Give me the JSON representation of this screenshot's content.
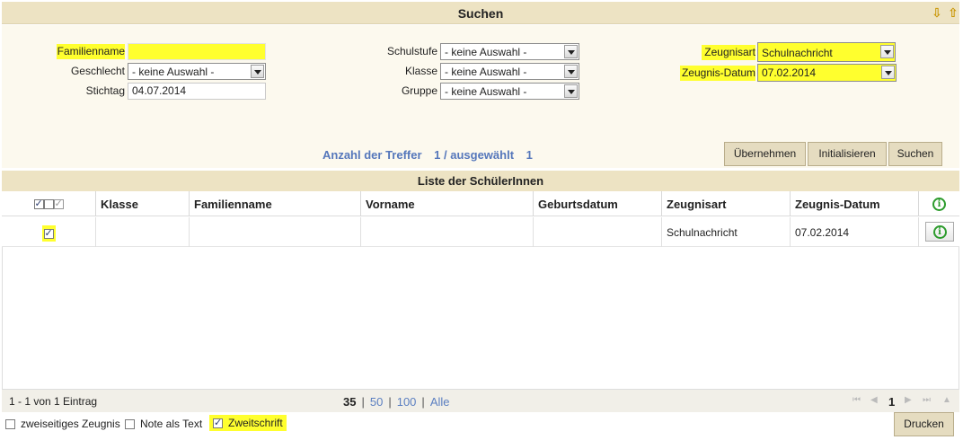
{
  "header": {
    "title": "Suchen",
    "arrow_down": "⇩",
    "arrow_up": "⇧"
  },
  "search": {
    "familienname": {
      "label": "Familienname",
      "value": ""
    },
    "geschlecht": {
      "label": "Geschlecht",
      "value": "- keine Auswahl -"
    },
    "stichtag": {
      "label": "Stichtag",
      "value": "04.07.2014"
    },
    "schulstufe": {
      "label": "Schulstufe",
      "value": "- keine Auswahl -"
    },
    "klasse": {
      "label": "Klasse",
      "value": "- keine Auswahl -"
    },
    "gruppe": {
      "label": "Gruppe",
      "value": "- keine Auswahl -"
    },
    "zeugnisart": {
      "label": "Zeugnisart",
      "value": "Schulnachricht"
    },
    "zeugnis_datum": {
      "label": "Zeugnis-Datum",
      "value": "07.02.2014"
    }
  },
  "hits": {
    "label": "Anzahl der Treffer",
    "count": "1 / ausgewählt",
    "selected": "1"
  },
  "buttons": {
    "uebernehmen": "Übernehmen",
    "initialisieren": "Initialisieren",
    "suchen": "Suchen"
  },
  "list": {
    "title": "Liste der SchülerInnen",
    "columns": [
      "Klasse",
      "Familienname",
      "Vorname",
      "Geburtsdatum",
      "Zeugnisart",
      "Zeugnis-Datum"
    ],
    "rows": [
      {
        "klasse": "",
        "familienname": "",
        "vorname": "",
        "geburtsdatum": "",
        "zeugnisart": "Schulnachricht",
        "zeugnis_datum": "07.02.2014",
        "checked": true
      }
    ]
  },
  "pager": {
    "info": "1 - 1 von 1 Eintrag",
    "sizes": [
      "35",
      "50",
      "100",
      "Alle"
    ],
    "current_page": "1"
  },
  "options": {
    "zweiseitig": {
      "label": "zweiseitiges Zeugnis",
      "checked": false
    },
    "note_als_text": {
      "label": "Note als Text",
      "checked": false
    },
    "zweitschrift": {
      "label": "Zweitschrift",
      "checked": true
    }
  },
  "print_button": "Drucken",
  "colors": {
    "header_bg": "#ede3c3",
    "highlight": "#ffff2e",
    "link_blue": "#5577bb",
    "info_green": "#2c9b2c"
  }
}
